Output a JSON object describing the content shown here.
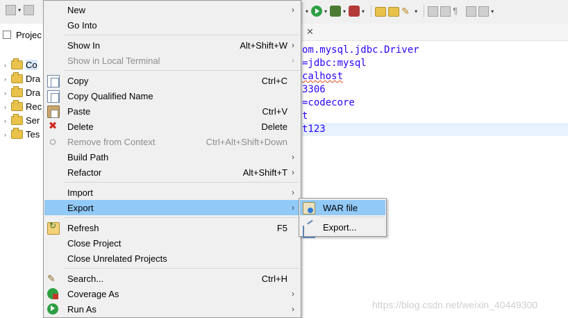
{
  "toolbar": {
    "icons": [
      "new-icon",
      "save-icon",
      "run-icon",
      "debug-icon",
      "coverage-icon",
      "open-folder-icon",
      "open-type-icon",
      "search-icon",
      "toggle-mark-icon",
      "pilcrow-icon",
      "edit-icon",
      "nav-icon"
    ]
  },
  "explorer": {
    "tab_label": "Projec",
    "items": [
      {
        "label": "Co",
        "selected": true
      },
      {
        "label": "Dra"
      },
      {
        "label": "Dra"
      },
      {
        "label": "Rec"
      },
      {
        "label": "Ser"
      },
      {
        "label": "Tes"
      }
    ]
  },
  "editor": {
    "close_glyph": "✕",
    "lines": [
      "om.mysql.jdbc.Driver",
      "=jdbc:mysql",
      "calhost",
      "3306",
      "=codecore",
      "t",
      "t123"
    ],
    "highlighted_line": 6
  },
  "context_menu": {
    "items": [
      {
        "label": "New",
        "submenu": true
      },
      {
        "label": "Go Into"
      },
      {
        "label": "Show In",
        "shortcut": "Alt+Shift+W",
        "submenu": true
      },
      {
        "label": "Show in Local Terminal",
        "submenu": true,
        "disabled": true
      },
      {
        "label": "Copy",
        "shortcut": "Ctrl+C",
        "icon": "copy-icon"
      },
      {
        "label": "Copy Qualified Name",
        "icon": "copy-qualified-icon"
      },
      {
        "label": "Paste",
        "shortcut": "Ctrl+V",
        "icon": "paste-icon"
      },
      {
        "label": "Delete",
        "shortcut": "Delete",
        "icon": "delete-icon"
      },
      {
        "label": "Remove from Context",
        "shortcut": "Ctrl+Alt+Shift+Down",
        "disabled": true,
        "icon": "remove-context-icon"
      },
      {
        "label": "Build Path",
        "submenu": true
      },
      {
        "label": "Refactor",
        "shortcut": "Alt+Shift+T",
        "submenu": true
      },
      {
        "label": "Import",
        "submenu": true
      },
      {
        "label": "Export",
        "submenu": true,
        "selected": true
      },
      {
        "label": "Refresh",
        "shortcut": "F5",
        "icon": "refresh-icon"
      },
      {
        "label": "Close Project"
      },
      {
        "label": "Close Unrelated Projects"
      },
      {
        "label": "Search...",
        "shortcut": "Ctrl+H",
        "icon": "search-icon"
      },
      {
        "label": "Coverage As",
        "submenu": true,
        "icon": "coverage-icon"
      },
      {
        "label": "Run As",
        "submenu": true,
        "icon": "run-icon"
      }
    ],
    "submenu_arrow": "›"
  },
  "export_submenu": {
    "items": [
      {
        "label": "WAR file",
        "icon": "war-file-icon",
        "selected": true
      },
      {
        "label": "Export...",
        "icon": "export-icon"
      }
    ]
  },
  "watermark": "https://blog.csdn.net/weixin_40449300"
}
